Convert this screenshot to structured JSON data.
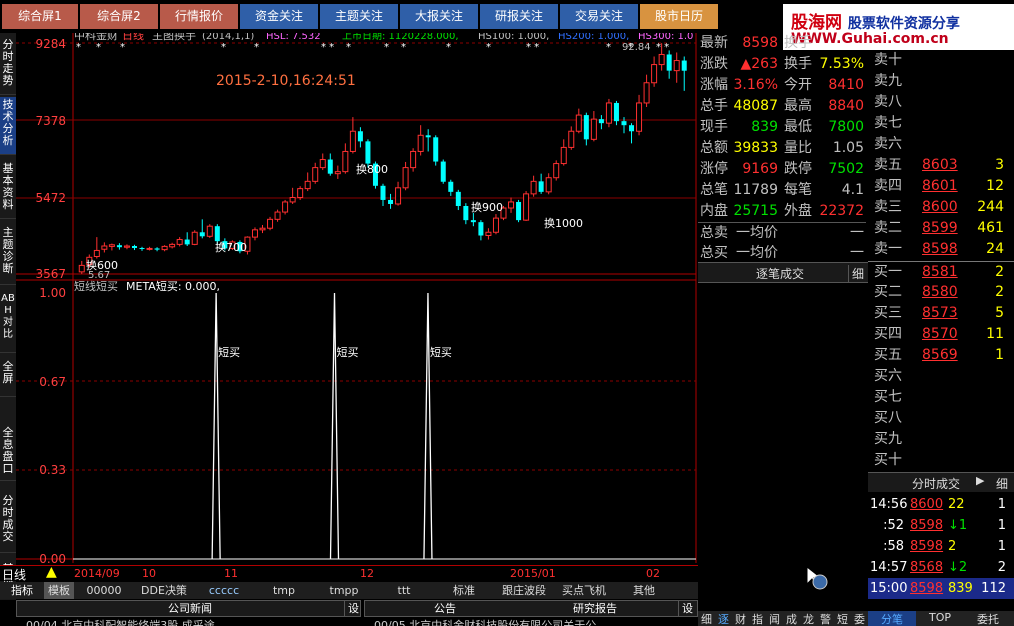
{
  "top_tabs": [
    {
      "label": "综合屏1"
    },
    {
      "label": "综合屏2"
    },
    {
      "label": "行情报价"
    },
    {
      "label": "资金关注"
    },
    {
      "label": "主题关注"
    },
    {
      "label": "大报关注"
    },
    {
      "label": "研报关注"
    },
    {
      "label": "交易关注"
    },
    {
      "label": "股市日历"
    }
  ],
  "logo": {
    "line1_a": "股海网",
    "line1_b": "股票软件资源分享",
    "line2": "WWW.Guhai.com.cn"
  },
  "left_sidebar": [
    "分时走势",
    "技术分析",
    "基本资料",
    "主题诊断",
    "ABH对比",
    "全屏",
    "全息盘口",
    "分时成交",
    "其他"
  ],
  "chart": {
    "stock_name": "中科金财",
    "period": "日线",
    "indicator": "主图换手",
    "indicator_params": "(2014,1,1)",
    "hsl_label": "HSL: 7.532",
    "listing_label": "上市日期: 1120228.000,",
    "hs100_label": "HS100: 1.000,",
    "hs200_label": "HS200: 1.000,",
    "hs300_label": "HS300: 1.0",
    "high_marker": "92.84",
    "low_marker": "5.67",
    "datetime": "2015-2-10,16:24:51",
    "price_axis": [
      "9284",
      "7378",
      "5472",
      "3567"
    ],
    "turnover_labels": [
      "换600",
      "换700",
      "换800",
      "换900",
      "换1000"
    ],
    "lower_title": "短线短买",
    "lower_formula": "META短买: 0.000,",
    "lower_axis": [
      "1.00",
      "0.67",
      "0.33",
      "0.00"
    ],
    "signal_label": "短买",
    "date_axis": [
      "2014/09",
      "10",
      "11",
      "12",
      "2015/01",
      "02"
    ],
    "period_bottom": "日线"
  },
  "candles": [
    {
      "o": 36.2,
      "c": 37.8,
      "h": 38.9,
      "l": 35.7
    },
    {
      "o": 38.0,
      "c": 39.8,
      "h": 40.5,
      "l": 37.2
    },
    {
      "o": 40.0,
      "c": 41.5,
      "h": 44.8,
      "l": 39.5
    },
    {
      "o": 41.8,
      "c": 42.6,
      "h": 43.5,
      "l": 41.0
    },
    {
      "o": 42.5,
      "c": 42.9,
      "h": 43.2,
      "l": 41.5
    },
    {
      "o": 42.8,
      "c": 42.3,
      "h": 43.3,
      "l": 41.7
    },
    {
      "o": 42.3,
      "c": 42.6,
      "h": 43.0,
      "l": 41.8
    },
    {
      "o": 42.6,
      "c": 42.1,
      "h": 42.9,
      "l": 41.6
    },
    {
      "o": 42.1,
      "c": 41.9,
      "h": 42.4,
      "l": 41.4
    },
    {
      "o": 41.9,
      "c": 42.0,
      "h": 42.4,
      "l": 41.5
    },
    {
      "o": 42.0,
      "c": 41.7,
      "h": 42.3,
      "l": 41.3
    },
    {
      "o": 41.7,
      "c": 42.5,
      "h": 42.8,
      "l": 41.3
    },
    {
      "o": 42.4,
      "c": 43.0,
      "h": 43.4,
      "l": 42.0
    },
    {
      "o": 43.0,
      "c": 44.2,
      "h": 44.8,
      "l": 42.5
    },
    {
      "o": 44.2,
      "c": 43.0,
      "h": 46.0,
      "l": 42.6
    },
    {
      "o": 43.0,
      "c": 46.0,
      "h": 46.5,
      "l": 42.8
    },
    {
      "o": 46.0,
      "c": 45.0,
      "h": 49.2,
      "l": 44.5
    },
    {
      "o": 45.0,
      "c": 47.5,
      "h": 48.0,
      "l": 44.6
    },
    {
      "o": 47.5,
      "c": 43.8,
      "h": 48.0,
      "l": 43.0
    },
    {
      "o": 43.8,
      "c": 42.0,
      "h": 44.5,
      "l": 41.5
    },
    {
      "o": 42.0,
      "c": 43.6,
      "h": 44.0,
      "l": 41.6
    },
    {
      "o": 43.6,
      "c": 41.3,
      "h": 44.0,
      "l": 40.8
    },
    {
      "o": 41.3,
      "c": 44.8,
      "h": 45.0,
      "l": 40.5
    },
    {
      "o": 44.8,
      "c": 46.6,
      "h": 47.2,
      "l": 44.0
    },
    {
      "o": 46.6,
      "c": 47.0,
      "h": 47.8,
      "l": 45.8
    },
    {
      "o": 47.0,
      "c": 49.2,
      "h": 49.8,
      "l": 46.5
    },
    {
      "o": 49.2,
      "c": 51.0,
      "h": 51.6,
      "l": 48.6
    },
    {
      "o": 51.0,
      "c": 53.5,
      "h": 54.0,
      "l": 50.4
    },
    {
      "o": 53.5,
      "c": 54.6,
      "h": 57.0,
      "l": 53.0
    },
    {
      "o": 54.6,
      "c": 56.8,
      "h": 57.4,
      "l": 54.0
    },
    {
      "o": 56.8,
      "c": 58.6,
      "h": 60.8,
      "l": 56.2
    },
    {
      "o": 58.6,
      "c": 62.0,
      "h": 63.2,
      "l": 58.0
    },
    {
      "o": 62.0,
      "c": 64.0,
      "h": 65.5,
      "l": 61.4
    },
    {
      "o": 64.0,
      "c": 60.5,
      "h": 65.5,
      "l": 60.0
    },
    {
      "o": 60.5,
      "c": 61.0,
      "h": 62.5,
      "l": 59.2
    },
    {
      "o": 61.0,
      "c": 66.0,
      "h": 68.0,
      "l": 60.5
    },
    {
      "o": 66.0,
      "c": 71.0,
      "h": 74.5,
      "l": 65.5
    },
    {
      "o": 71.0,
      "c": 68.5,
      "h": 72.0,
      "l": 67.0
    },
    {
      "o": 68.5,
      "c": 63.0,
      "h": 69.0,
      "l": 62.0
    },
    {
      "o": 63.0,
      "c": 57.5,
      "h": 63.5,
      "l": 56.8
    },
    {
      "o": 57.5,
      "c": 54.0,
      "h": 58.0,
      "l": 52.5
    },
    {
      "o": 54.0,
      "c": 53.0,
      "h": 55.5,
      "l": 51.8
    },
    {
      "o": 53.0,
      "c": 57.0,
      "h": 58.5,
      "l": 52.6
    },
    {
      "o": 57.0,
      "c": 62.0,
      "h": 63.4,
      "l": 56.4
    },
    {
      "o": 62.0,
      "c": 66.0,
      "h": 66.8,
      "l": 61.0
    },
    {
      "o": 66.0,
      "c": 70.0,
      "h": 72.5,
      "l": 65.0
    },
    {
      "o": 70.0,
      "c": 69.5,
      "h": 71.5,
      "l": 66.0
    },
    {
      "o": 69.5,
      "c": 63.5,
      "h": 70.0,
      "l": 62.5
    },
    {
      "o": 63.5,
      "c": 58.5,
      "h": 64.0,
      "l": 58.0
    },
    {
      "o": 58.5,
      "c": 56.0,
      "h": 59.0,
      "l": 55.0
    },
    {
      "o": 56.0,
      "c": 52.5,
      "h": 56.5,
      "l": 51.5
    },
    {
      "o": 52.5,
      "c": 49.0,
      "h": 53.2,
      "l": 48.0
    },
    {
      "o": 49.0,
      "c": 48.5,
      "h": 50.8,
      "l": 47.5
    },
    {
      "o": 48.5,
      "c": 45.2,
      "h": 49.0,
      "l": 44.0
    },
    {
      "o": 45.2,
      "c": 46.0,
      "h": 47.0,
      "l": 44.2
    },
    {
      "o": 46.0,
      "c": 49.5,
      "h": 50.5,
      "l": 45.5
    },
    {
      "o": 49.5,
      "c": 52.0,
      "h": 52.5,
      "l": 49.0
    },
    {
      "o": 52.0,
      "c": 53.5,
      "h": 54.6,
      "l": 50.8
    },
    {
      "o": 53.5,
      "c": 49.0,
      "h": 54.0,
      "l": 48.5
    },
    {
      "o": 49.0,
      "c": 55.5,
      "h": 56.2,
      "l": 48.8
    },
    {
      "o": 55.5,
      "c": 58.6,
      "h": 60.0,
      "l": 54.8
    },
    {
      "o": 58.6,
      "c": 56.0,
      "h": 60.5,
      "l": 55.5
    },
    {
      "o": 56.0,
      "c": 59.5,
      "h": 60.6,
      "l": 55.4
    },
    {
      "o": 59.5,
      "c": 63.0,
      "h": 63.8,
      "l": 58.8
    },
    {
      "o": 63.0,
      "c": 67.0,
      "h": 69.0,
      "l": 62.5
    },
    {
      "o": 67.0,
      "c": 71.0,
      "h": 72.2,
      "l": 66.4
    },
    {
      "o": 71.0,
      "c": 75.0,
      "h": 76.6,
      "l": 70.5
    },
    {
      "o": 75.0,
      "c": 69.0,
      "h": 75.6,
      "l": 67.5
    },
    {
      "o": 69.0,
      "c": 74.0,
      "h": 76.0,
      "l": 68.5
    },
    {
      "o": 74.0,
      "c": 73.0,
      "h": 75.0,
      "l": 71.5
    },
    {
      "o": 73.0,
      "c": 78.0,
      "h": 79.0,
      "l": 72.0
    },
    {
      "o": 78.0,
      "c": 73.5,
      "h": 78.5,
      "l": 72.5
    },
    {
      "o": 73.5,
      "c": 72.5,
      "h": 74.5,
      "l": 70.5
    },
    {
      "o": 72.5,
      "c": 71.0,
      "h": 73.0,
      "l": 68.0
    },
    {
      "o": 71.0,
      "c": 78.0,
      "h": 80.0,
      "l": 70.0
    },
    {
      "o": 78.0,
      "c": 83.0,
      "h": 85.0,
      "l": 77.0
    },
    {
      "o": 83.0,
      "c": 87.5,
      "h": 89.5,
      "l": 82.0
    },
    {
      "o": 87.5,
      "c": 90.0,
      "h": 92.8,
      "l": 86.0
    },
    {
      "o": 90.0,
      "c": 86.0,
      "h": 91.0,
      "l": 84.0
    },
    {
      "o": 86.0,
      "c": 88.5,
      "h": 90.5,
      "l": 83.0
    },
    {
      "o": 88.5,
      "c": 85.98,
      "h": 89.5,
      "l": 81.0
    }
  ],
  "signals": [
    0.31,
    0.5,
    0.65
  ],
  "quote": {
    "rows": [
      {
        "l": "最新",
        "v": "8598",
        "l2": "换手",
        "v2": ""
      },
      {
        "l": "涨跌",
        "v": "▲263",
        "l2": "换手",
        "v2": "7.53%"
      },
      {
        "l": "涨幅",
        "v": "3.16%",
        "l2": "今开",
        "v2": "8410"
      },
      {
        "l": "总手",
        "v": "48087",
        "l2": "最高",
        "v2": "8840"
      },
      {
        "l": "现手",
        "v": "839",
        "l2": "最低",
        "v2": "7800"
      },
      {
        "l": "总额",
        "v": "39833",
        "l2": "量比",
        "v2": "1.05"
      },
      {
        "l": "涨停",
        "v": "9169",
        "l2": "跌停",
        "v2": "7502"
      },
      {
        "l": "总笔",
        "v": "11789",
        "l2": "每笔",
        "v2": "4.1"
      },
      {
        "l": "内盘",
        "v": "25715",
        "l2": "外盘",
        "v2": "22372"
      },
      {
        "l": "总卖",
        "v": "一均价",
        "l2": "",
        "v2": "一"
      },
      {
        "l": "总买",
        "v": "一均价",
        "l2": "",
        "v2": "一"
      }
    ],
    "trades_title": "逐笔成交",
    "trades_btn": "细"
  },
  "order_book": {
    "asks": [
      {
        "label": "卖十",
        "price": "",
        "qty": ""
      },
      {
        "label": "卖九",
        "price": "",
        "qty": ""
      },
      {
        "label": "卖八",
        "price": "",
        "qty": ""
      },
      {
        "label": "卖七",
        "price": "",
        "qty": ""
      },
      {
        "label": "卖六",
        "price": "",
        "qty": ""
      },
      {
        "label": "卖五",
        "price": "8603",
        "qty": "3"
      },
      {
        "label": "卖四",
        "price": "8601",
        "qty": "12"
      },
      {
        "label": "卖三",
        "price": "8600",
        "qty": "244"
      },
      {
        "label": "卖二",
        "price": "8599",
        "qty": "461"
      },
      {
        "label": "卖一",
        "price": "8598",
        "qty": "24"
      }
    ],
    "bids": [
      {
        "label": "买一",
        "price": "8581",
        "qty": "2"
      },
      {
        "label": "买二",
        "price": "8580",
        "qty": "2"
      },
      {
        "label": "买三",
        "price": "8573",
        "qty": "5"
      },
      {
        "label": "买四",
        "price": "8570",
        "qty": "11"
      },
      {
        "label": "买五",
        "price": "8569",
        "qty": "1"
      },
      {
        "label": "买六",
        "price": "",
        "qty": ""
      },
      {
        "label": "买七",
        "price": "",
        "qty": ""
      },
      {
        "label": "买八",
        "price": "",
        "qty": ""
      },
      {
        "label": "买九",
        "price": "",
        "qty": ""
      },
      {
        "label": "买十",
        "price": "",
        "qty": ""
      }
    ]
  },
  "ticks": {
    "title": "分时成交",
    "detail_btn": "细",
    "rows": [
      {
        "time": "14:56",
        "price": "8600",
        "vol": "22",
        "n": "1"
      },
      {
        "time": ":52",
        "price": "8598",
        "vol": "↓1",
        "n": "1"
      },
      {
        "time": ":58",
        "price": "8598",
        "vol": "2",
        "n": "1"
      },
      {
        "time": "14:57",
        "price": "8568",
        "vol": "↓2",
        "n": "2"
      },
      {
        "time": "15:00",
        "price": "8598",
        "vol": "839",
        "n": "112"
      }
    ]
  },
  "bottom": {
    "formula_tabs": [
      "指标",
      "模板",
      "00000",
      "DDE决策",
      "ccccc",
      "tmp",
      "tmpp",
      "ttt",
      "标准",
      "跟庄波段",
      "买点飞机",
      "其他"
    ],
    "news_tabs": [
      "公司新闻",
      "设",
      "公告",
      "研究报告",
      "设"
    ],
    "news_snip_1": "00/04 北京中科配智能终端3股 成采途",
    "news_snip_2": "00/05 北京中科金财科技股份有限公司关于公",
    "right_tabs": [
      "细",
      "逐",
      "财",
      "指",
      "闻",
      "成",
      "龙",
      "警",
      "短",
      "委"
    ],
    "right_tabs2": [
      "分笔",
      "TOP",
      "委托"
    ]
  },
  "colors": {
    "up": "#ff3030",
    "down": "#00ffff",
    "ma_red": "#ff4040",
    "grid": "#8b0000",
    "frame": "#b00000"
  }
}
